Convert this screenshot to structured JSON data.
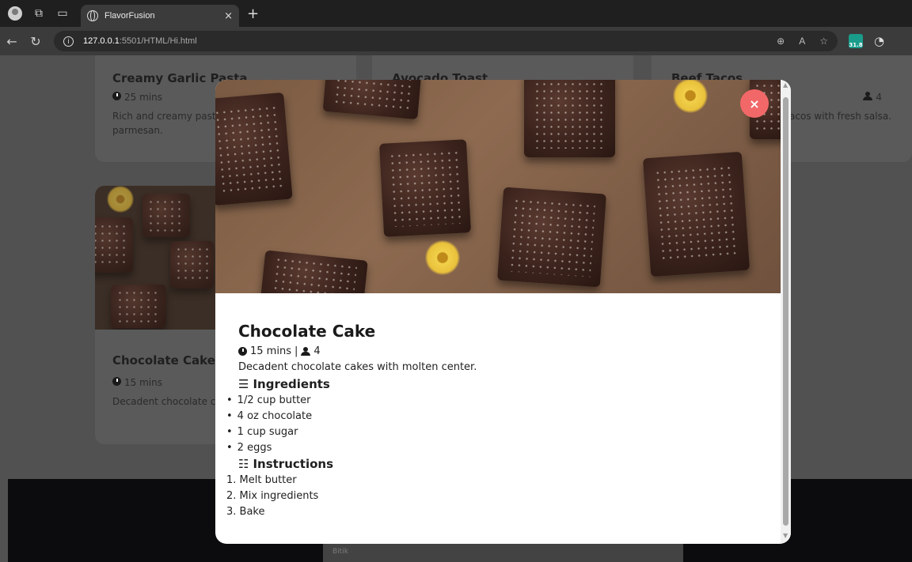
{
  "browser": {
    "tab_title": "FlavorFusion",
    "tab_close": "×",
    "new_tab": "+",
    "url_host": "127.0.0.1",
    "url_path": ":5501/HTML/Hi.html",
    "extension_badge": "31.8"
  },
  "background_cards": [
    {
      "title": "Creamy Garlic Pasta",
      "time": "25 mins",
      "desc": "Rich and creamy pasta with garlic and parmesan."
    },
    {
      "title": "Avocado Toast"
    },
    {
      "title": "Beef Tacos",
      "servings": "4",
      "desc": "Tacos with fresh salsa."
    },
    {
      "title": "Chocolate Cake",
      "time": "15 mins",
      "desc": "Decadent chocolate cakes with molten center."
    }
  ],
  "footer": {
    "text": "Bitik"
  },
  "modal": {
    "close_label": "×",
    "title": "Chocolate Cake",
    "time": "15 mins",
    "separator": "|",
    "servings": "4",
    "description": "Decadent chocolate cakes with molten center.",
    "ingredients_heading": "Ingredients",
    "ingredients": [
      "1/2 cup butter",
      "4 oz chocolate",
      "1 cup sugar",
      "2 eggs"
    ],
    "instructions_heading": "Instructions",
    "instructions": [
      "1. Melt butter",
      "2. Mix ingredients",
      "3. Bake"
    ]
  }
}
